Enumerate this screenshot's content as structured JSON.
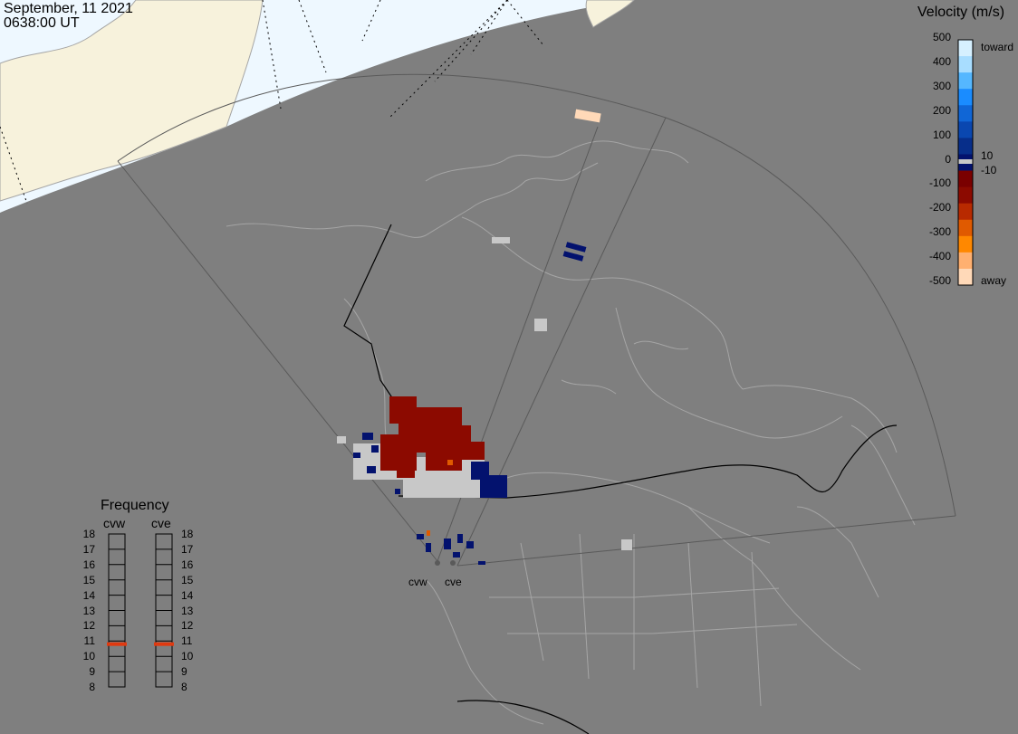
{
  "header": {
    "date": "September, 11 2021",
    "time": "0638:00 UT"
  },
  "velocity_scale": {
    "title": "Velocity (m/s)",
    "ticks": [
      "500",
      "400",
      "300",
      "200",
      "100",
      "0",
      "-100",
      "-200",
      "-300",
      "-400",
      "-500"
    ],
    "toward_label": "toward",
    "away_label": "away",
    "plus_label": "10",
    "minus_label": "-10",
    "colors": [
      "#d6f0ff",
      "#a8ddff",
      "#55b7ff",
      "#1a8cff",
      "#1066d6",
      "#0a47b0",
      "#072e8a",
      "#03126e",
      "#7a0000",
      "#8c0a00",
      "#b82a00",
      "#e05a00",
      "#ff8800",
      "#ffb070",
      "#ffd9b8"
    ]
  },
  "frequency": {
    "title": "Frequency",
    "radars": [
      "cvw",
      "cve"
    ],
    "levels": [
      "18",
      "17",
      "16",
      "15",
      "14",
      "13",
      "12",
      "11",
      "10",
      "9",
      "8"
    ],
    "selected": [
      10.8,
      10.8
    ],
    "marker_color": "#e03a10"
  },
  "radar_labels": [
    "cvw",
    "cve"
  ],
  "colors": {
    "background": "#7f7f7f",
    "day": "#eef8ff",
    "land_day": "#f7f2dc",
    "outline": "#a5a5a5",
    "border": "#000000",
    "ground_scatter": "#c8c8c8"
  }
}
